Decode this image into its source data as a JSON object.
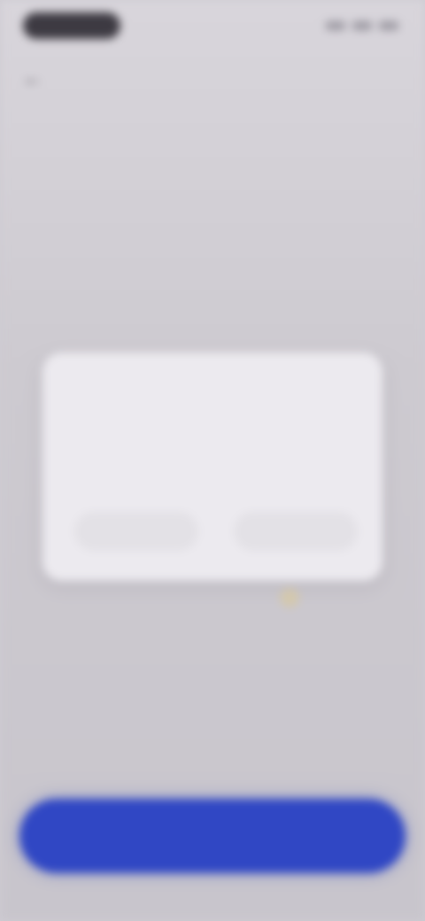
{
  "status_bar": {
    "time": "",
    "icons": [
      "signal-icon",
      "wifi-icon",
      "battery-icon"
    ]
  },
  "header": {
    "back_icon": "arrow-left-icon",
    "back_glyph": "←",
    "title": ""
  },
  "headline": "",
  "dialog": {
    "title": "",
    "body": "",
    "cancel_label": "",
    "confirm_label": ""
  },
  "primary_button": {
    "label": ""
  },
  "colors": {
    "background": "#cfccd3",
    "dialog": "#eceaef",
    "primary": "#3047c4"
  }
}
